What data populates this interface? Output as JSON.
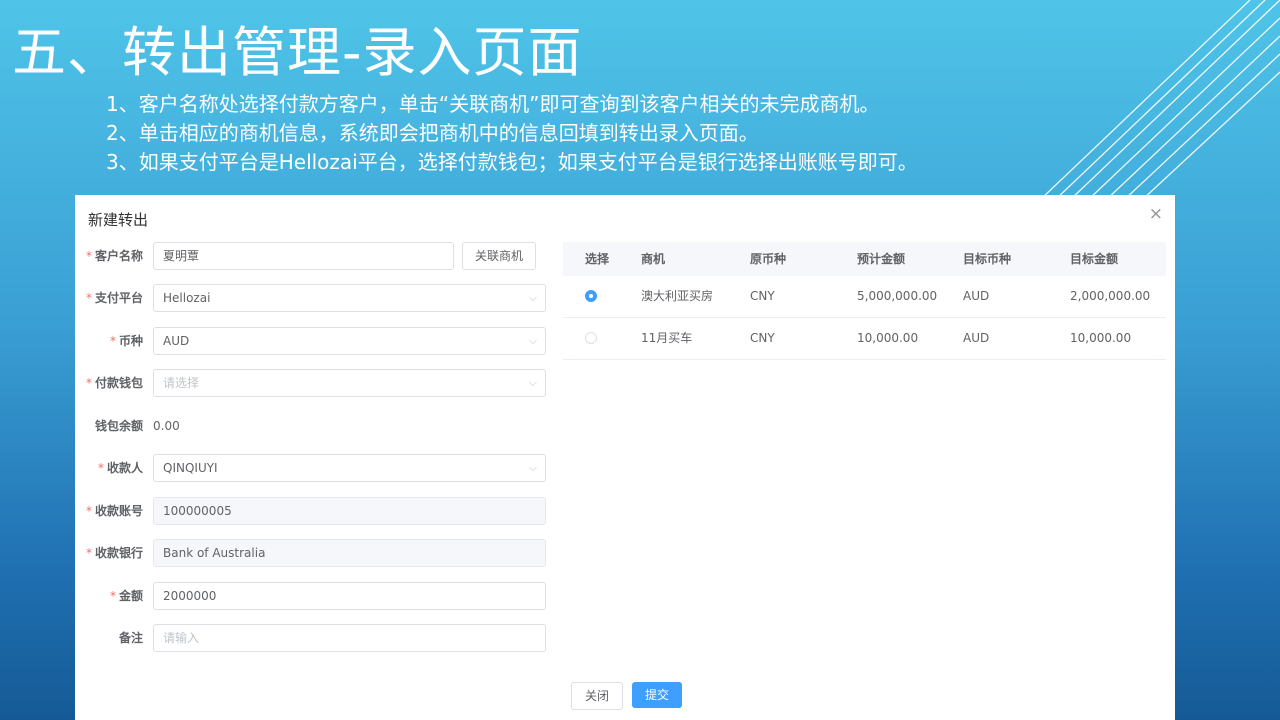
{
  "slide": {
    "title": "五、转出管理-录入页面",
    "notes": [
      "1、客户名称处选择付款方客户，单击“关联商机”即可查询到该客户相关的未完成商机。",
      "2、单击相应的商机信息，系统即会把商机中的信息回填到转出录入页面。",
      "3、如果支付平台是Hellozai平台，选择付款钱包；如果支付平台是银行选择出账账号即可。"
    ]
  },
  "dialog": {
    "title": "新建转出",
    "close_icon": "×",
    "required_mark": "*",
    "chevron": "⌵",
    "form": {
      "customer": {
        "label": "客户名称",
        "value": "夏明覃",
        "link_button": "关联商机"
      },
      "platform": {
        "label": "支付平台",
        "value": "Hellozai"
      },
      "currency": {
        "label": "币种",
        "value": "AUD"
      },
      "wallet": {
        "label": "付款钱包",
        "placeholder": "请选择"
      },
      "balance": {
        "label": "钱包余额",
        "value": "0.00"
      },
      "payee": {
        "label": "收款人",
        "value": "QINQIUYI"
      },
      "account": {
        "label": "收款账号",
        "value": "100000005"
      },
      "bank": {
        "label": "收款银行",
        "value": "Bank of Australia"
      },
      "amount": {
        "label": "金额",
        "value": "2000000"
      },
      "remark": {
        "label": "备注",
        "placeholder": "请输入"
      }
    },
    "table": {
      "headers": [
        "选择",
        "商机",
        "原币种",
        "预计金额",
        "目标币种",
        "目标金额"
      ],
      "rows": [
        {
          "selected": true,
          "opportunity": "澳大利亚买房",
          "src_currency": "CNY",
          "est_amount": "5,000,000.00",
          "target_currency": "AUD",
          "target_amount": "2,000,000.00"
        },
        {
          "selected": false,
          "opportunity": "11月买车",
          "src_currency": "CNY",
          "est_amount": "10,000.00",
          "target_currency": "AUD",
          "target_amount": "10,000.00"
        }
      ]
    },
    "buttons": {
      "close": "关闭",
      "submit": "提交"
    }
  }
}
